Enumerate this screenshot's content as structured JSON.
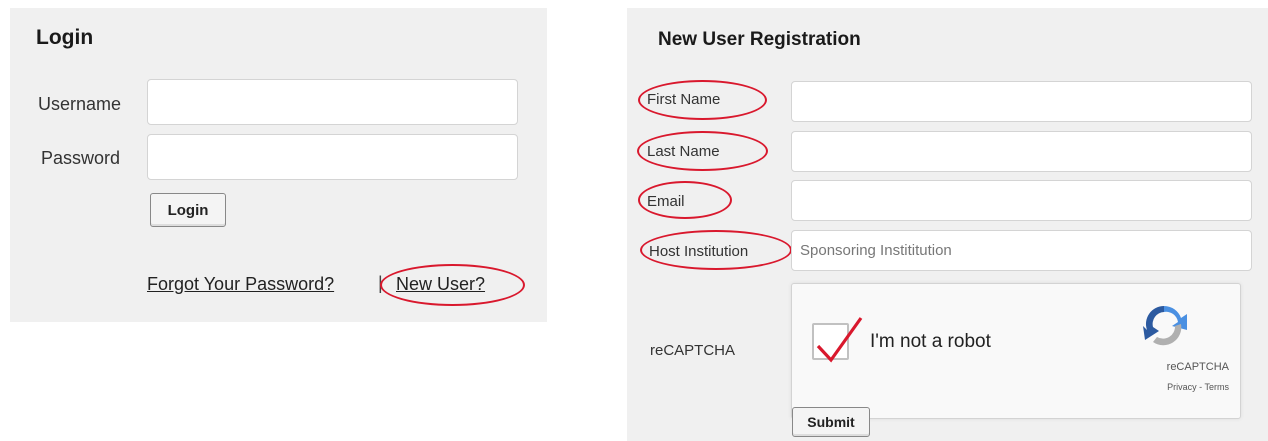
{
  "login": {
    "title": "Login",
    "username_label": "Username",
    "username_value": "",
    "password_label": "Password",
    "password_value": "",
    "login_button": "Login",
    "forgot_link": "Forgot Your Password?",
    "separator": "|",
    "new_user_link": "New User?"
  },
  "registration": {
    "title": "New User Registration",
    "first_name_label": "First Name",
    "first_name_value": "",
    "last_name_label": "Last Name",
    "last_name_value": "",
    "email_label": "Email",
    "email_value": "",
    "host_label": "Host Institution",
    "host_value": "",
    "host_placeholder": "Sponsoring Instititution",
    "recaptcha_label": "reCAPTCHA",
    "captcha_text": "I'm not a robot",
    "captcha_brand": "reCAPTCHA",
    "captcha_links": "Privacy - Terms",
    "captcha_checked": true,
    "submit_button": "Submit"
  },
  "colors": {
    "panel_bg": "#f0f0f0",
    "highlight_circle": "#d9182d",
    "checkmark": "#d9182d",
    "captcha_blue": "#4a90e2",
    "captcha_gray": "#b0b0b0"
  },
  "icons": [
    "checkmark-icon",
    "recaptcha-logo-icon"
  ]
}
